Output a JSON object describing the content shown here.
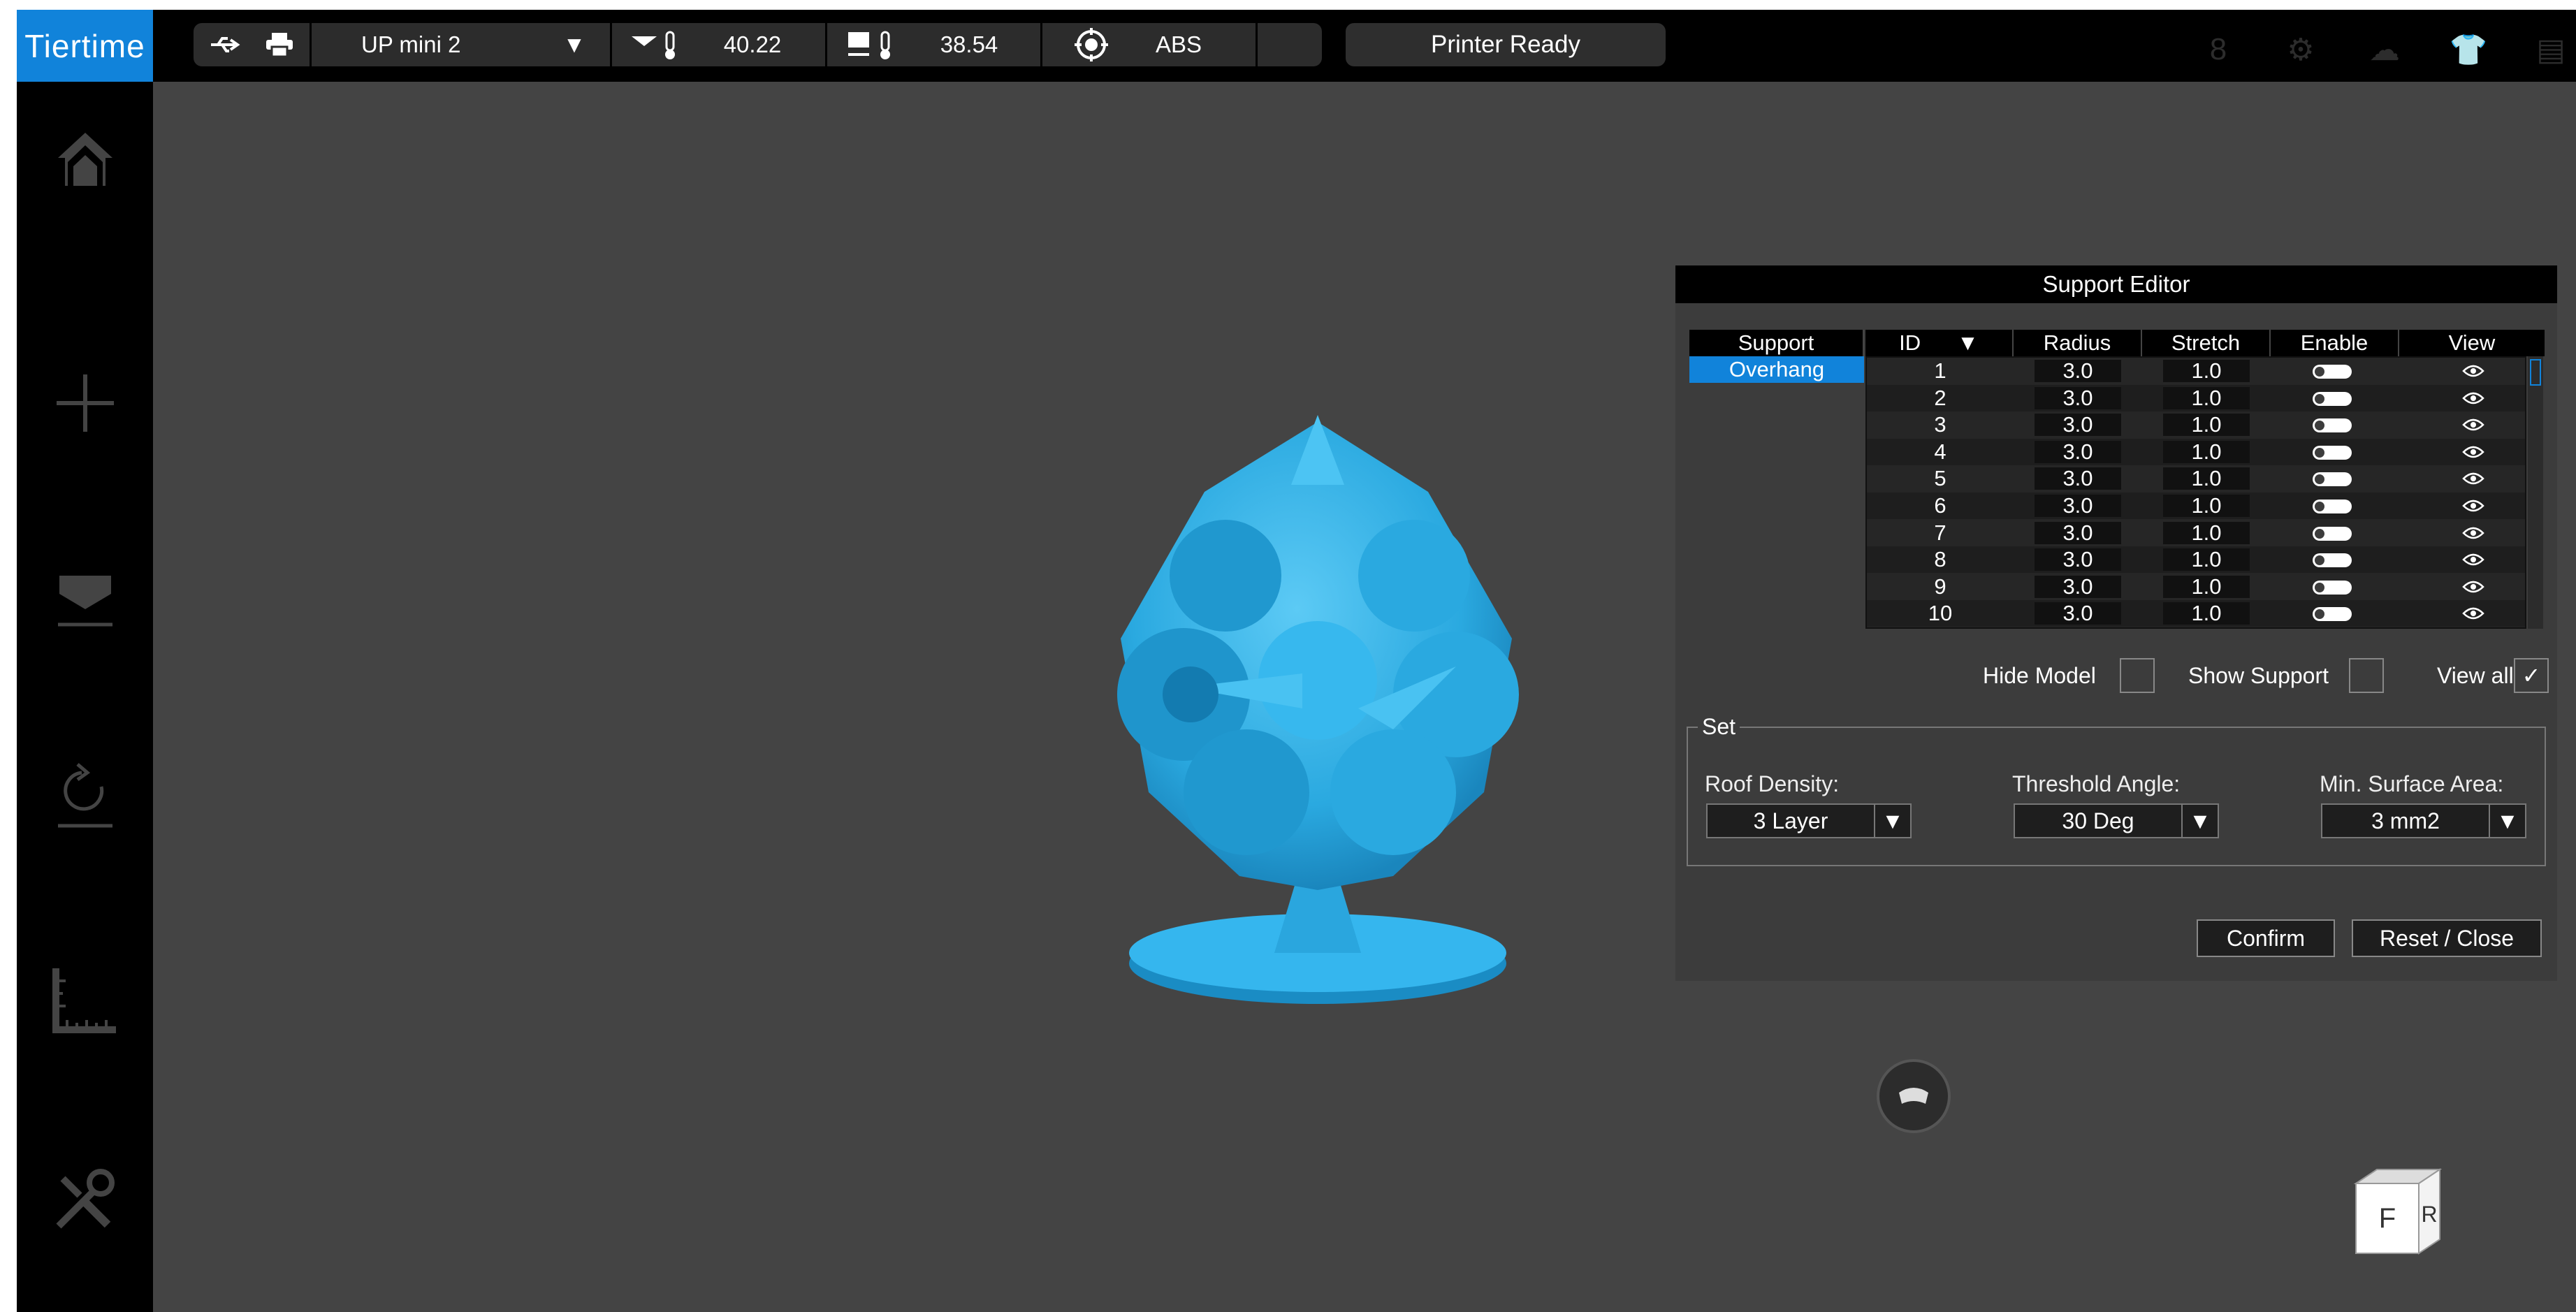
{
  "app": {
    "logo": "Tiertime"
  },
  "topbar": {
    "printer_name": "UP mini 2",
    "nozzle_temp": "40.22",
    "bed_temp": "38.54",
    "material": "ABS",
    "status": "Printer Ready",
    "icons": [
      "usb-icon",
      "printer-icon",
      "dropdown-arrow-icon",
      "nozzle-temp-icon",
      "bed-temp-icon",
      "target-icon",
      "user-icon",
      "settings-icon",
      "cloud-icon",
      "shirt-icon",
      "notes-icon"
    ]
  },
  "sidebar": {
    "items": [
      "home-icon",
      "add-icon",
      "print-icon",
      "calibrate-icon",
      "measure-icon",
      "tools-icon"
    ]
  },
  "support_editor": {
    "title": "Support Editor",
    "headers": {
      "support": "Support",
      "id": "ID",
      "radius": "Radius",
      "stretch": "Stretch",
      "enable": "Enable",
      "view": "View"
    },
    "support_type": "Overhang",
    "rows": [
      {
        "id": "1",
        "radius": "3.0",
        "stretch": "1.0"
      },
      {
        "id": "2",
        "radius": "3.0",
        "stretch": "1.0"
      },
      {
        "id": "3",
        "radius": "3.0",
        "stretch": "1.0"
      },
      {
        "id": "4",
        "radius": "3.0",
        "stretch": "1.0"
      },
      {
        "id": "5",
        "radius": "3.0",
        "stretch": "1.0"
      },
      {
        "id": "6",
        "radius": "3.0",
        "stretch": "1.0"
      },
      {
        "id": "7",
        "radius": "3.0",
        "stretch": "1.0"
      },
      {
        "id": "8",
        "radius": "3.0",
        "stretch": "1.0"
      },
      {
        "id": "9",
        "radius": "3.0",
        "stretch": "1.0"
      },
      {
        "id": "10",
        "radius": "3.0",
        "stretch": "1.0"
      }
    ],
    "options": {
      "hide_model": "Hide Model",
      "show_support": "Show Support",
      "view_all": "View all",
      "view_all_checked": true
    },
    "set": {
      "legend": "Set",
      "roof_density_label": "Roof Density:",
      "roof_density_value": "3 Layer",
      "threshold_angle_label": "Threshold Angle:",
      "threshold_angle_value": "30 Deg",
      "min_surface_label": "Min. Surface Area:",
      "min_surface_value": "3 mm2"
    },
    "confirm": "Confirm",
    "reset_close": "Reset / Close"
  },
  "viewcube": {
    "front": "F",
    "right": "R"
  },
  "colors": {
    "accent": "#1183da",
    "model": "#33b5ee",
    "viewport": "#444444"
  }
}
